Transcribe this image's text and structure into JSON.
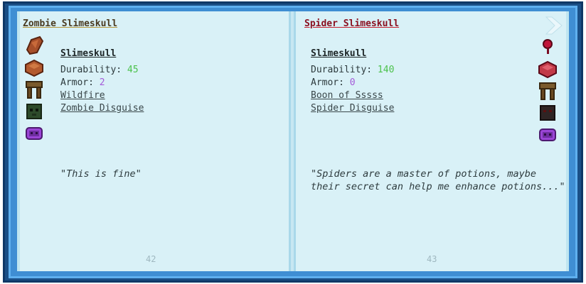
{
  "left_page": {
    "title": "Zombie Slimeskull",
    "item_name": "Slimeskull",
    "durability_label": "Durability:",
    "durability_value": "45",
    "armor_label": "Armor:",
    "armor_value": "2",
    "trait_1": "Wildfire",
    "trait_2": "Zombie Disguise",
    "quote": "\"This is fine\"",
    "page_number": "42",
    "icons": [
      "leather-icon",
      "leather-block-icon",
      "wood-stand-icon",
      "zombie-head-icon",
      "purple-slime-helm-icon"
    ]
  },
  "right_page": {
    "title": "Spider Slimeskull",
    "item_name": "Slimeskull",
    "durability_label": "Durability:",
    "durability_value": "140",
    "armor_label": "Armor:",
    "armor_value": "0",
    "trait_1": "Boon of Sssss",
    "trait_2": "Spider Disguise",
    "quote_line_1": "\"Spiders are a master of potions, maybe",
    "quote_line_2": "their secret can help me enhance potions...\"",
    "page_number": "43",
    "icons": [
      "spider-eye-icon",
      "fermented-eye-block-icon",
      "wood-stand-icon",
      "spider-head-icon",
      "purple-slime-helm-icon"
    ]
  },
  "colors": {
    "frame_dark": "#1a4f86",
    "frame_mid": "#3f8ed3",
    "page_bg": "#d9f1f7",
    "stat_green": "#4cc24c",
    "stat_purple": "#a45ad9",
    "zombie_title": "#4a3a20",
    "spider_title": "#8a1020"
  }
}
